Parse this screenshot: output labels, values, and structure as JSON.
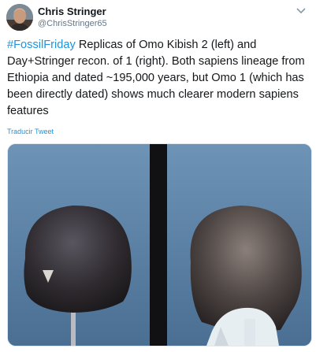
{
  "author": {
    "name": "Chris Stringer",
    "handle": "@ChrisStringer65",
    "avatar_icon": "user-avatar"
  },
  "menu_icon": "chevron-down-icon",
  "tweet": {
    "hashtag": "#FossilFriday",
    "text": " Replicas of Omo Kibish 2 (left) and Day+Stringer recon. of 1 (right). Both sapiens lineage from Ethiopia and dated ~195,000 years, but Omo 1 (which has been directly dated) shows much clearer modern sapiens features"
  },
  "translate_link": "Traducir Tweet",
  "colors": {
    "link": "#1b95e0",
    "text": "#14171a",
    "secondary": "#657786"
  }
}
